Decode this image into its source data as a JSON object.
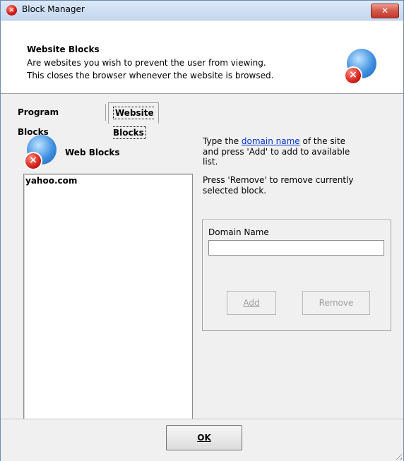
{
  "window": {
    "title": "Block Manager",
    "close_glyph": "✕"
  },
  "header": {
    "title": "Website Blocks",
    "desc_line1": "Are websites you wish to prevent the user from viewing.",
    "desc_line2": "This closes the browser whenever the website is browsed.",
    "icon": "globe-block-icon"
  },
  "tabs": [
    {
      "label": "Program Blocks",
      "selected": false
    },
    {
      "label": "Website Blocks",
      "selected": true
    }
  ],
  "panel": {
    "title": "Web Blocks",
    "list_items": [
      "yahoo.com"
    ],
    "instructions": {
      "prefix": "Type the ",
      "link_text": "domain name",
      "suffix_line1": " of the site",
      "line2": "and press 'Add' to add to available",
      "line3": "list.",
      "line4": "Press 'Remove' to remove currently",
      "line5": "selected block."
    },
    "domain_label": "Domain Name",
    "domain_value": "",
    "add_label": "Add",
    "remove_label": "Remove"
  },
  "footer": {
    "ok_label": "OK"
  },
  "colors": {
    "link": "#0033cc",
    "close_button": "#c3392b",
    "accent_blue": "#3f90e0"
  }
}
